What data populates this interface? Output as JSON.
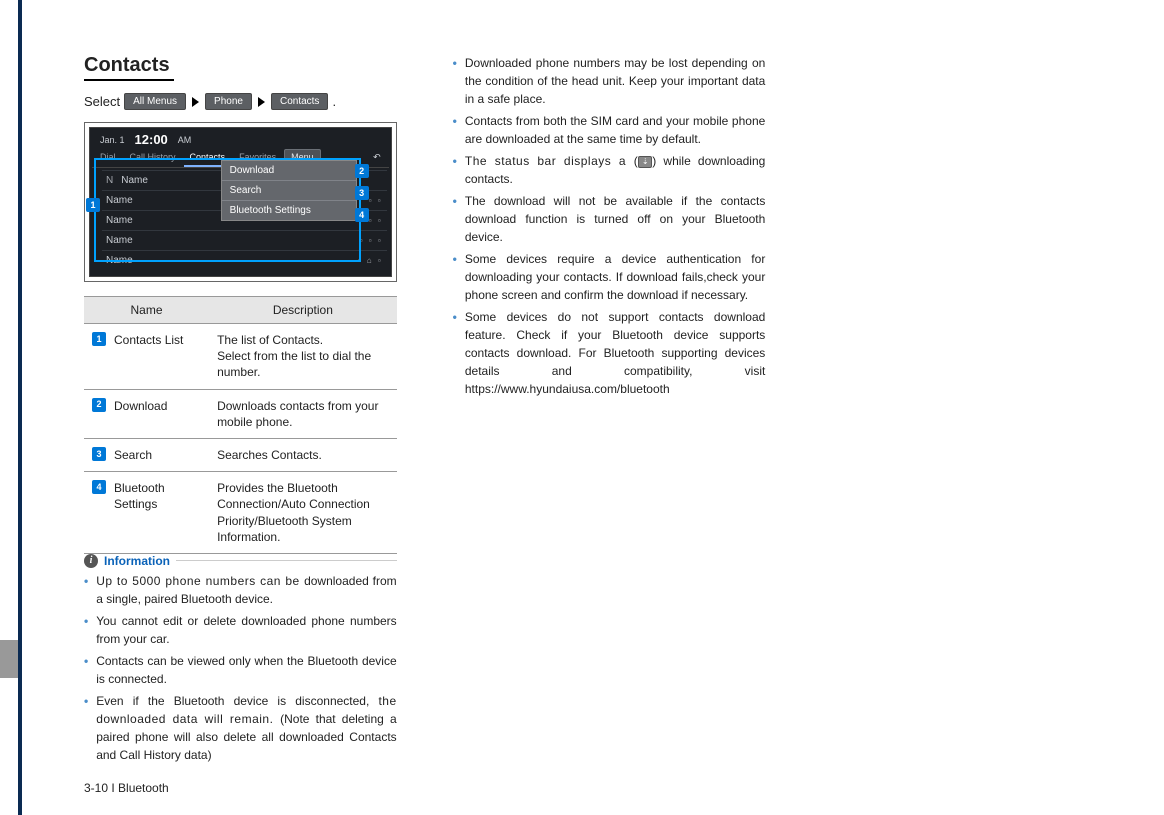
{
  "title": "Contacts",
  "select_label": "Select",
  "breadcrumb": {
    "a": "All Menus",
    "b": "Phone",
    "c": "Contacts"
  },
  "period": ".",
  "screenshot": {
    "date": "Jan. 1",
    "time": "12:00",
    "ampm": "AM",
    "tabs": {
      "dial": "Dial",
      "history": "Call History",
      "contacts": "Contacts",
      "fav": "Favorites",
      "menu": "Menu",
      "back": "↶"
    },
    "col_n": "N",
    "col_name": "Name",
    "row_name": "Name",
    "menu_items": {
      "download": "Download",
      "search": "Search",
      "bt": "Bluetooth Settings"
    },
    "callouts": {
      "c1": "1",
      "c2": "2",
      "c3": "3",
      "c4": "4"
    }
  },
  "table": {
    "head_name": "Name",
    "head_desc": "Description",
    "rows": {
      "r1": {
        "n": "1",
        "name": "Contacts List",
        "desc": "The list of Contacts.\nSelect from the list to dial the number."
      },
      "r2": {
        "n": "2",
        "name": "Download",
        "desc": "Downloads contacts from your mobile phone."
      },
      "r3": {
        "n": "3",
        "name": "Search",
        "desc": "Searches Contacts."
      },
      "r4": {
        "n": "4",
        "name": "Bluetooth Settings",
        "desc": "Provides the Bluetooth Connection/Auto Connection Priority/Bluetooth System Information."
      }
    }
  },
  "info_label": "Information",
  "info": {
    "i1a": "Up to 5000 phone numbers can be ",
    "i1b": "downloaded from a single, paired Bluetooth device.",
    "i2": "You cannot edit or delete downloaded phone numbers from your car.",
    "i3": "Contacts can be viewed only when the Bluetooth device is connected.",
    "i4a": "Even if the Bluetooth device is disconnected, ",
    "i4b": "the downloaded data will remain. ",
    "i4c": "(Note that deleting a paired phone will also delete all downloaded Contacts and Call History data)",
    "i5": "Downloaded phone numbers may be lost depending on the condition of the head unit. Keep your important data in a safe place.",
    "i6": "Contacts from both the SIM card and your mobile phone are downloaded at the same time by default.",
    "i7a": "The status bar displays a (",
    "i7b": ") while downloading contacts.",
    "i8": "The download will not be available if the contacts download function is turned off on your Bluetooth device.",
    "i9": "Some devices require a device authentication for downloading your contacts. If download fails,check your phone screen and confirm the download if necessary.",
    "i10": "Some devices do not support contacts download feature. Check if your Bluetooth device supports contacts download. For Bluetooth supporting devices details and compatibility, visit https://www.hyundaiusa.com/bluetooth"
  },
  "footer": "3-10 I Bluetooth"
}
